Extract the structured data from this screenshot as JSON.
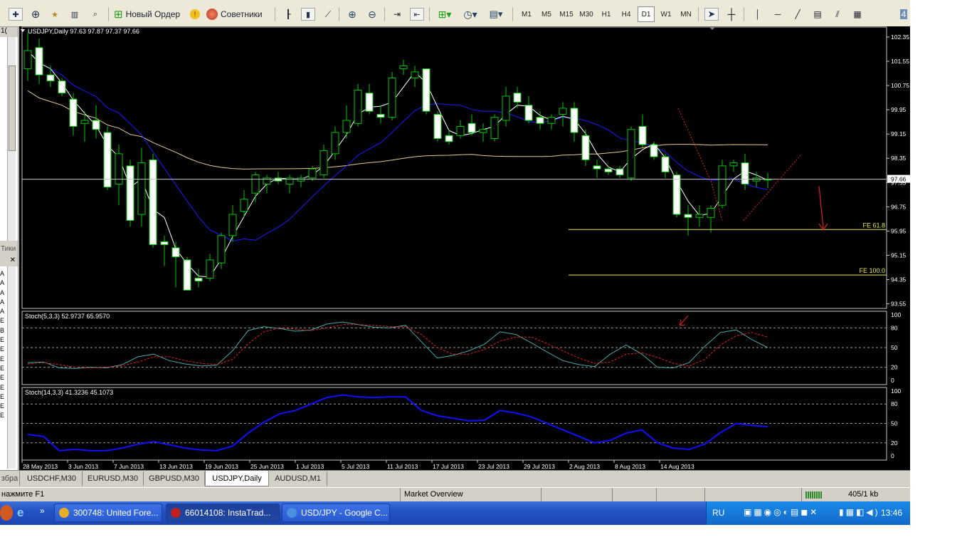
{
  "toolbar": {
    "new_order_label": "Новый Ордер",
    "advisors_label": "Советники",
    "timeframes": [
      "M1",
      "M5",
      "M15",
      "M30",
      "H1",
      "H4",
      "D1",
      "W1",
      "MN"
    ],
    "active_timeframe": "D1"
  },
  "left_panel": {
    "top_number": "1(",
    "ticks_label": "Тики",
    "letters": [
      "А",
      "А",
      "А",
      "А",
      "А",
      "Е",
      "В",
      "Е",
      "Е",
      "Е",
      "Е",
      "Е",
      "Е",
      "Е",
      "Е",
      "Е"
    ]
  },
  "chart": {
    "header": "USDJPY,Daily  97.63 97.87 97.37 97.66",
    "price_axis": [
      "102.35",
      "101.55",
      "100.75",
      "99.95",
      "99.15",
      "98.35",
      "97.55",
      "96.75",
      "95.95",
      "95.15",
      "94.35",
      "93.55"
    ],
    "current_price": "97.66",
    "fe_61": "FE 61.8",
    "fe_100": "FE 100.0",
    "stoch1_header": "Stoch(5,3,3) 52.9737 65.9570",
    "stoch1_levels": [
      "100",
      "80",
      "50",
      "20",
      "0"
    ],
    "stoch2_header": "Stoch(14,3,3) 41.3236 45.1073",
    "stoch2_levels": [
      "100",
      "80",
      "50",
      "20",
      "0"
    ],
    "dates": [
      "28 May 2013",
      "3 Jun 2013",
      "7 Jun 2013",
      "13 Jun 2013",
      "19 Jun 2013",
      "25 Jun 2013",
      "1 Jul 2013",
      "5 Jul 2013",
      "11 Jul 2013",
      "17 Jul 2013",
      "23 Jul 2013",
      "29 Jul 2013",
      "2 Aug 2013",
      "8 Aug 2013",
      "14 Aug 2013"
    ],
    "colors": {
      "bull": "#000000",
      "bear": "#ffffff",
      "wick": "#00c800",
      "ma_fast": "#ffffff",
      "ma_mid": "#1a1aff",
      "ma_slow": "#e8c890",
      "fe": "#e8e850",
      "stoch_main": "#4aa6a6",
      "stoch_signal": "#e02020",
      "stoch2": "#1010ff"
    }
  },
  "chart_data": {
    "type": "candlestick",
    "symbol": "USDJPY",
    "timeframe": "Daily",
    "ohlc": [
      [
        101.3,
        102.5,
        100.9,
        101.9
      ],
      [
        102.0,
        102.3,
        100.8,
        101.1
      ],
      [
        101.1,
        101.4,
        100.7,
        100.9
      ],
      [
        100.9,
        101.0,
        100.4,
        100.5
      ],
      [
        100.3,
        100.5,
        99.1,
        99.4
      ],
      [
        99.5,
        99.9,
        98.9,
        99.6
      ],
      [
        99.6,
        100.1,
        99.0,
        99.3
      ],
      [
        99.2,
        99.4,
        97.3,
        97.4
      ],
      [
        97.5,
        98.8,
        96.8,
        98.5
      ],
      [
        98.1,
        98.3,
        96.1,
        96.3
      ],
      [
        96.5,
        98.7,
        96.1,
        98.2
      ],
      [
        98.3,
        98.5,
        95.4,
        95.5
      ],
      [
        95.6,
        95.8,
        94.8,
        95.5
      ],
      [
        95.4,
        95.6,
        94.1,
        95.1
      ],
      [
        95.0,
        95.1,
        94.6,
        94.0
      ],
      [
        94.4,
        94.7,
        94.1,
        94.3
      ],
      [
        94.4,
        95.2,
        94.3,
        95.0
      ],
      [
        94.9,
        95.9,
        94.7,
        95.8
      ],
      [
        95.8,
        96.8,
        95.6,
        96.5
      ],
      [
        96.6,
        97.3,
        96.4,
        97.0
      ],
      [
        97.2,
        97.9,
        96.9,
        97.8
      ],
      [
        97.5,
        97.8,
        97.2,
        97.7
      ],
      [
        97.7,
        97.9,
        97.5,
        97.6
      ],
      [
        97.5,
        97.8,
        97.2,
        97.7
      ],
      [
        97.6,
        97.8,
        97.4,
        97.7
      ],
      [
        97.7,
        98.1,
        97.6,
        98.0
      ],
      [
        97.8,
        98.8,
        97.7,
        98.6
      ],
      [
        98.5,
        99.4,
        98.3,
        99.2
      ],
      [
        99.2,
        100.1,
        99.0,
        99.6
      ],
      [
        99.5,
        100.8,
        99.4,
        100.6
      ],
      [
        100.5,
        100.8,
        99.8,
        99.9
      ],
      [
        99.8,
        100.1,
        99.5,
        99.7
      ],
      [
        99.7,
        101.2,
        99.6,
        101.0
      ],
      [
        101.3,
        101.6,
        101.1,
        101.4
      ],
      [
        101.0,
        101.4,
        100.7,
        101.2
      ],
      [
        101.3,
        101.3,
        99.8,
        99.9
      ],
      [
        99.8,
        99.9,
        98.9,
        99.0
      ],
      [
        99.1,
        99.3,
        98.8,
        98.9
      ],
      [
        99.1,
        99.6,
        99.0,
        99.4
      ],
      [
        99.5,
        99.8,
        99.1,
        99.2
      ],
      [
        99.2,
        99.5,
        98.9,
        99.3
      ],
      [
        99.0,
        99.8,
        98.9,
        99.7
      ],
      [
        99.6,
        100.7,
        99.4,
        100.4
      ],
      [
        100.5,
        100.7,
        100.0,
        100.2
      ],
      [
        100.1,
        100.4,
        99.5,
        99.6
      ],
      [
        99.7,
        99.9,
        99.3,
        99.5
      ],
      [
        99.5,
        99.8,
        99.3,
        99.7
      ],
      [
        99.8,
        100.2,
        99.4,
        100.0
      ],
      [
        100.0,
        100.2,
        98.9,
        99.2
      ],
      [
        99.1,
        99.3,
        98.1,
        98.3
      ],
      [
        98.1,
        98.3,
        97.7,
        98.0
      ],
      [
        98.0,
        98.1,
        97.8,
        97.9
      ],
      [
        98.0,
        98.1,
        97.7,
        97.8
      ],
      [
        97.7,
        99.4,
        97.6,
        99.3
      ],
      [
        99.4,
        99.8,
        98.7,
        98.8
      ],
      [
        98.8,
        98.9,
        98.3,
        98.4
      ],
      [
        98.4,
        98.5,
        97.7,
        97.9
      ],
      [
        97.8,
        97.9,
        96.4,
        96.5
      ],
      [
        96.5,
        96.8,
        95.8,
        96.4
      ],
      [
        96.4,
        96.8,
        96.1,
        96.5
      ],
      [
        96.4,
        96.8,
        95.9,
        96.7
      ],
      [
        96.8,
        98.3,
        96.7,
        98.1
      ],
      [
        98.1,
        98.3,
        97.9,
        98.2
      ],
      [
        98.2,
        98.5,
        97.3,
        97.5
      ],
      [
        97.6,
        97.9,
        97.4,
        97.7
      ],
      [
        97.63,
        97.87,
        97.37,
        97.66
      ]
    ],
    "fe_61_8": 96.0,
    "fe_100": 94.5,
    "stoch1_main": [
      27,
      28,
      19,
      18,
      20,
      19,
      24,
      36,
      40,
      30,
      25,
      22,
      23,
      45,
      76,
      82,
      79,
      75,
      77,
      86,
      89,
      85,
      81,
      80,
      84,
      59,
      34,
      38,
      45,
      55,
      74,
      70,
      57,
      43,
      30,
      24,
      21,
      40,
      54,
      40,
      20,
      19,
      27,
      52,
      73,
      77,
      62,
      50
    ],
    "stoch1_signal": [
      25,
      27,
      24,
      20,
      19,
      20,
      22,
      28,
      36,
      36,
      30,
      26,
      24,
      32,
      56,
      74,
      80,
      78,
      76,
      80,
      85,
      85,
      84,
      82,
      82,
      70,
      50,
      40,
      40,
      47,
      60,
      66,
      66,
      56,
      45,
      34,
      26,
      28,
      40,
      42,
      35,
      26,
      22,
      32,
      54,
      68,
      73,
      66
    ],
    "stoch2": [
      33,
      30,
      8,
      10,
      8,
      8,
      12,
      18,
      22,
      17,
      12,
      9,
      8,
      15,
      35,
      52,
      65,
      70,
      80,
      90,
      94,
      91,
      90,
      91,
      91,
      70,
      62,
      58,
      54,
      55,
      70,
      66,
      60,
      50,
      40,
      30,
      20,
      24,
      35,
      40,
      20,
      12,
      10,
      18,
      36,
      50,
      47,
      45
    ]
  },
  "tabs": [
    "USDCHF,M30",
    "EURUSD,M30",
    "GBPUSD,M30",
    "USDJPY,Daily",
    "AUDUSD,M1"
  ],
  "active_tab": "USDJPY,Daily",
  "left_tab": "збра",
  "status": {
    "help": "нажмите F1",
    "profile": "Market Overview",
    "traffic": "405/1 kb"
  },
  "taskbar": {
    "tasks": [
      "300748: United Fore...",
      "66014108: InstaTrad...",
      "USD/JPY - Google C..."
    ],
    "lang": "RU",
    "clock": "13:46"
  }
}
